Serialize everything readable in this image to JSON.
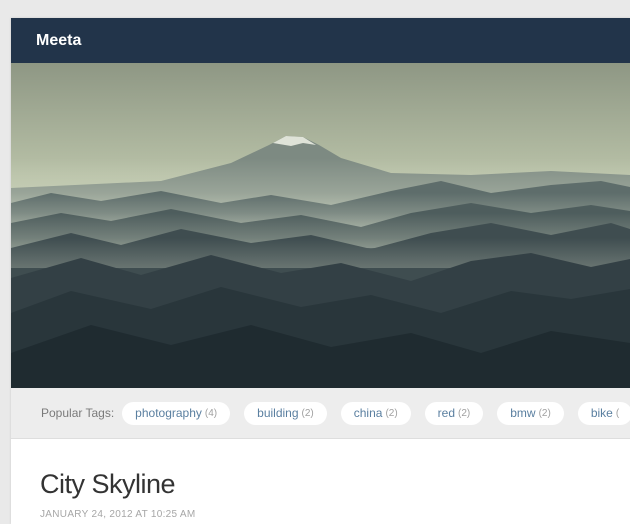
{
  "site": {
    "title": "Meeta"
  },
  "tags": {
    "label": "Popular Tags:",
    "items": [
      {
        "name": "photography",
        "count": "(4)"
      },
      {
        "name": "building",
        "count": "(2)"
      },
      {
        "name": "china",
        "count": "(2)"
      },
      {
        "name": "red",
        "count": "(2)"
      },
      {
        "name": "bmw",
        "count": "(2)"
      },
      {
        "name": "bike",
        "count": "("
      }
    ]
  },
  "post": {
    "title": "City Skyline",
    "date": "JANUARY 24, 2012 AT 10:25 AM"
  },
  "colors": {
    "topbar": "#22344a",
    "tag_text": "#5a7fa0",
    "page_bg": "#e9e9e9"
  }
}
